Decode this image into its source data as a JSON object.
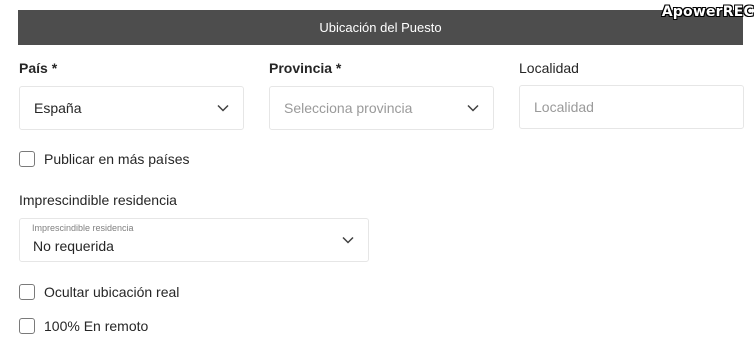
{
  "header": {
    "title": "Ubicación del Puesto",
    "watermark": "ApowerREC"
  },
  "country": {
    "label": "País *",
    "value": "España"
  },
  "province": {
    "label": "Provincia *",
    "placeholder": "Selecciona provincia"
  },
  "locality": {
    "label": "Localidad",
    "placeholder": "Localidad"
  },
  "publish_more": {
    "label": "Publicar en más países",
    "checked": false
  },
  "residence": {
    "section_label": "Imprescindible residencia",
    "floating_label": "Imprescindible residencia",
    "value": "No requerida"
  },
  "hide_location": {
    "label": "Ocultar ubicación real",
    "checked": false
  },
  "remote": {
    "label": "100% En remoto",
    "checked": false
  },
  "icons": {
    "dropdown": "chevron-down-icon",
    "checkbox": "checkbox-unchecked-icon"
  }
}
